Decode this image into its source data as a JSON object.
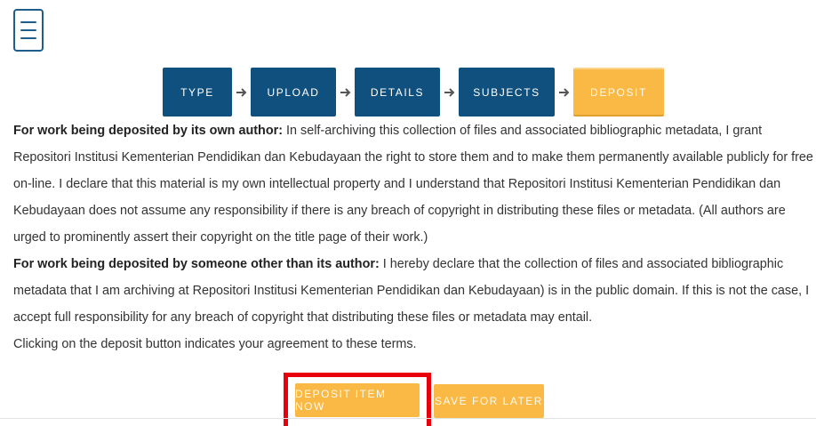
{
  "menu": {
    "icon": "hamburger-menu-icon"
  },
  "steps": [
    {
      "label": "TYPE",
      "state": "complete"
    },
    {
      "label": "UPLOAD",
      "state": "complete"
    },
    {
      "label": "DETAILS",
      "state": "complete"
    },
    {
      "label": "SUBJECTS",
      "state": "complete"
    },
    {
      "label": "DEPOSIT",
      "state": "current"
    }
  ],
  "agreement": {
    "own_author_heading": "For work being deposited by its own author:",
    "own_author_text": " In self-archiving this collection of files and associated bibliographic metadata, I grant Repositori Institusi Kementerian Pendidikan dan Kebudayaan the right to store them and to make them permanently available publicly for free on-line. I declare that this material is my own intellectual property and I understand that Repositori Institusi Kementerian Pendidikan dan Kebudayaan does not assume any responsibility if there is any breach of copyright in distributing these files or metadata. (All authors are urged to prominently assert their copyright on the title page of their work.)",
    "other_author_heading": "For work being deposited by someone other than its author:",
    "other_author_text": " I hereby declare that the collection of files and associated bibliographic metadata that I am archiving at Repositori Institusi Kementerian Pendidikan dan Kebudayaan) is in the public domain. If this is not the case, I accept full responsibility for any breach of copyright that distributing these files or metadata may entail.",
    "footer_text": "Clicking on the deposit button indicates your agreement to these terms."
  },
  "actions": {
    "deposit_label": "DEPOSIT ITEM NOW",
    "save_label": "SAVE FOR LATER"
  },
  "colors": {
    "step_complete": "#10507f",
    "step_current": "#f9b944",
    "button": "#f9b944",
    "highlight": "#e8000b"
  }
}
